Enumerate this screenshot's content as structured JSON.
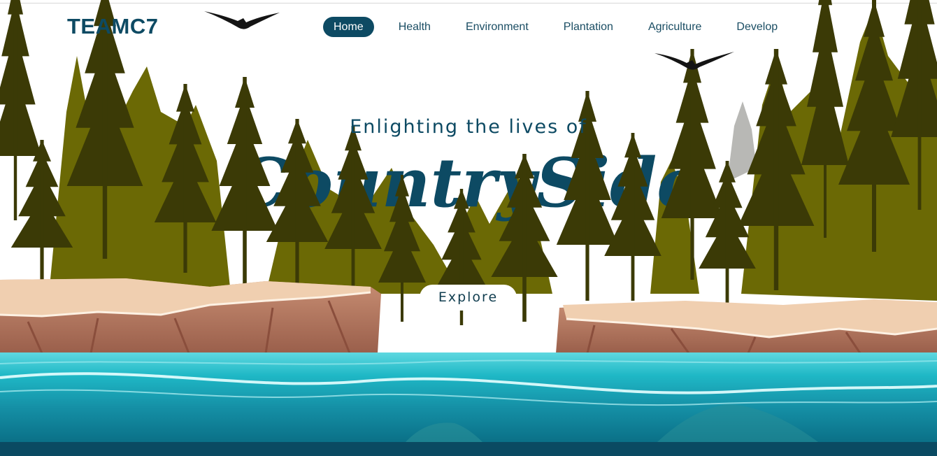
{
  "brand": {
    "name": "TEAMC7"
  },
  "nav": {
    "items": [
      {
        "label": "Home",
        "active": true
      },
      {
        "label": "Health",
        "active": false
      },
      {
        "label": "Environment",
        "active": false
      },
      {
        "label": "Plantation",
        "active": false
      },
      {
        "label": "Agriculture",
        "active": false
      },
      {
        "label": "Develop",
        "active": false
      }
    ]
  },
  "hero": {
    "tagline": "Enlighting the lives of",
    "headline": "CountrySide",
    "cta_label": "Explore"
  },
  "colors": {
    "brand": "#0d4a63",
    "pine_dark": "#3b3a06",
    "pine_olive": "#6b6905",
    "cliff": "#b97c63",
    "cliff_top": "#f0cfb0",
    "water": "#14a8b8",
    "water_deep": "#0a6f86"
  }
}
